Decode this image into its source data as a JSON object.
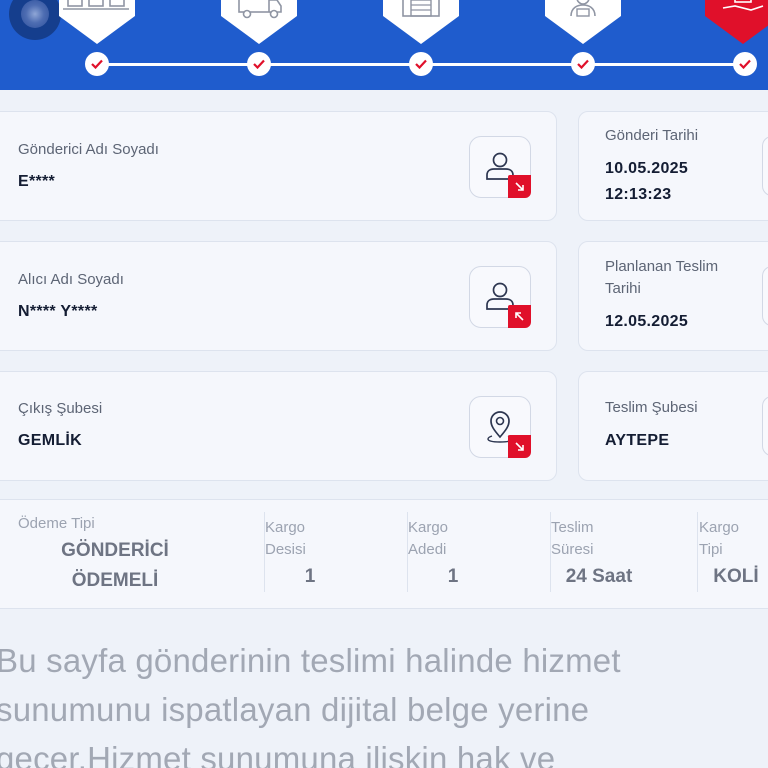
{
  "stepper": {
    "steps": [
      {
        "icon": "conveyor-boxes-icon",
        "done": true
      },
      {
        "icon": "delivery-truck-icon",
        "done": true
      },
      {
        "icon": "warehouse-icon",
        "done": true
      },
      {
        "icon": "courier-person-icon",
        "done": true
      },
      {
        "icon": "hand-package-icon",
        "done": true,
        "active": true
      }
    ],
    "colors": {
      "header": "#1f5ccd",
      "check": "#e0102a",
      "active": "#e0102a"
    }
  },
  "sender": {
    "label": "Gönderici Adı Soyadı",
    "value": "E****"
  },
  "receiver": {
    "label": "Alıcı Adı Soyadı",
    "value": "N**** Y****"
  },
  "origin_branch": {
    "label": "Çıkış Şubesi",
    "value": "GEMLİK"
  },
  "send_date": {
    "label": "Gönderi Tarihi",
    "date": "10.05.2025",
    "time": "12:13:23"
  },
  "planned_delivery": {
    "label_line1": "Planlanan Teslim",
    "label_line2": "Tarihi",
    "value": "12.05.2025"
  },
  "delivery_branch": {
    "label": "Teslim Şubesi",
    "value": "AYTEPE"
  },
  "summary": {
    "payment": {
      "label": "Ödeme Tipi",
      "value_line1": "GÖNDERİCİ",
      "value_line2": "ÖDEMELİ"
    },
    "desi": {
      "label_line1": "Kargo",
      "label_line2": "Desisi",
      "value": "1"
    },
    "count": {
      "label_line1": "Kargo",
      "label_line2": "Adedi",
      "value": "1"
    },
    "duration": {
      "label_line1": "Teslim",
      "label_line2": "Süresi",
      "value": "24 Saat"
    },
    "type": {
      "label_line1": "Kargo",
      "label_line2": "Tipi",
      "value": "KOLİ"
    }
  },
  "paragraph": {
    "line1": "Bu sayfa gönderinin teslimi halinde hizmet",
    "line2": "sunumunu ispatlayan dijital belge yerine",
    "line3": "geçer.Hizmet sunumuna ilişkin hak ve"
  }
}
